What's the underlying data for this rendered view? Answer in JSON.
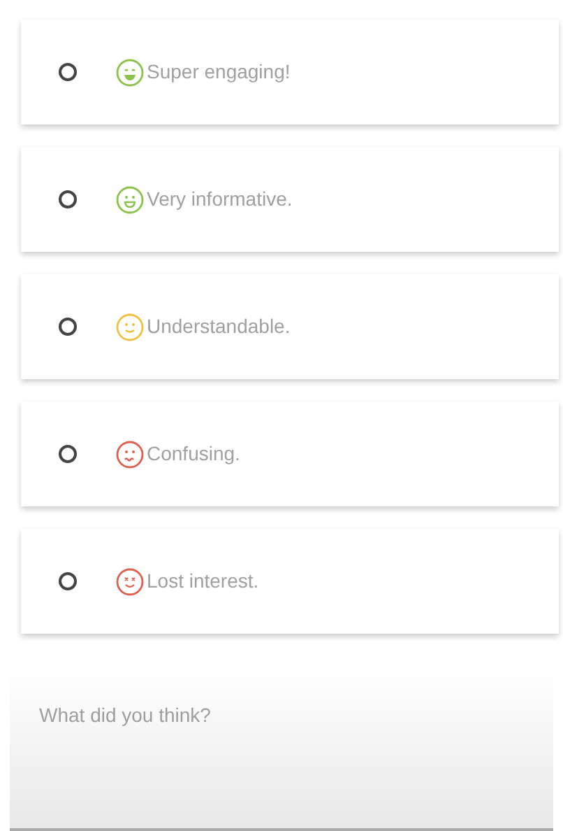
{
  "options": [
    {
      "label": "Super engaging!",
      "selected": false,
      "kind": "grin",
      "color": "#8bc34a"
    },
    {
      "label": "Very informative.",
      "selected": false,
      "kind": "happy",
      "color": "#8bc34a"
    },
    {
      "label": "Understandable.",
      "selected": false,
      "kind": "smile",
      "color": "#f0c040"
    },
    {
      "label": "Confusing.",
      "selected": false,
      "kind": "frown",
      "color": "#e06050"
    },
    {
      "label": "Lost interest.",
      "selected": false,
      "kind": "dizzy",
      "color": "#e06050"
    }
  ],
  "comment": {
    "placeholder": "What did you think?"
  }
}
